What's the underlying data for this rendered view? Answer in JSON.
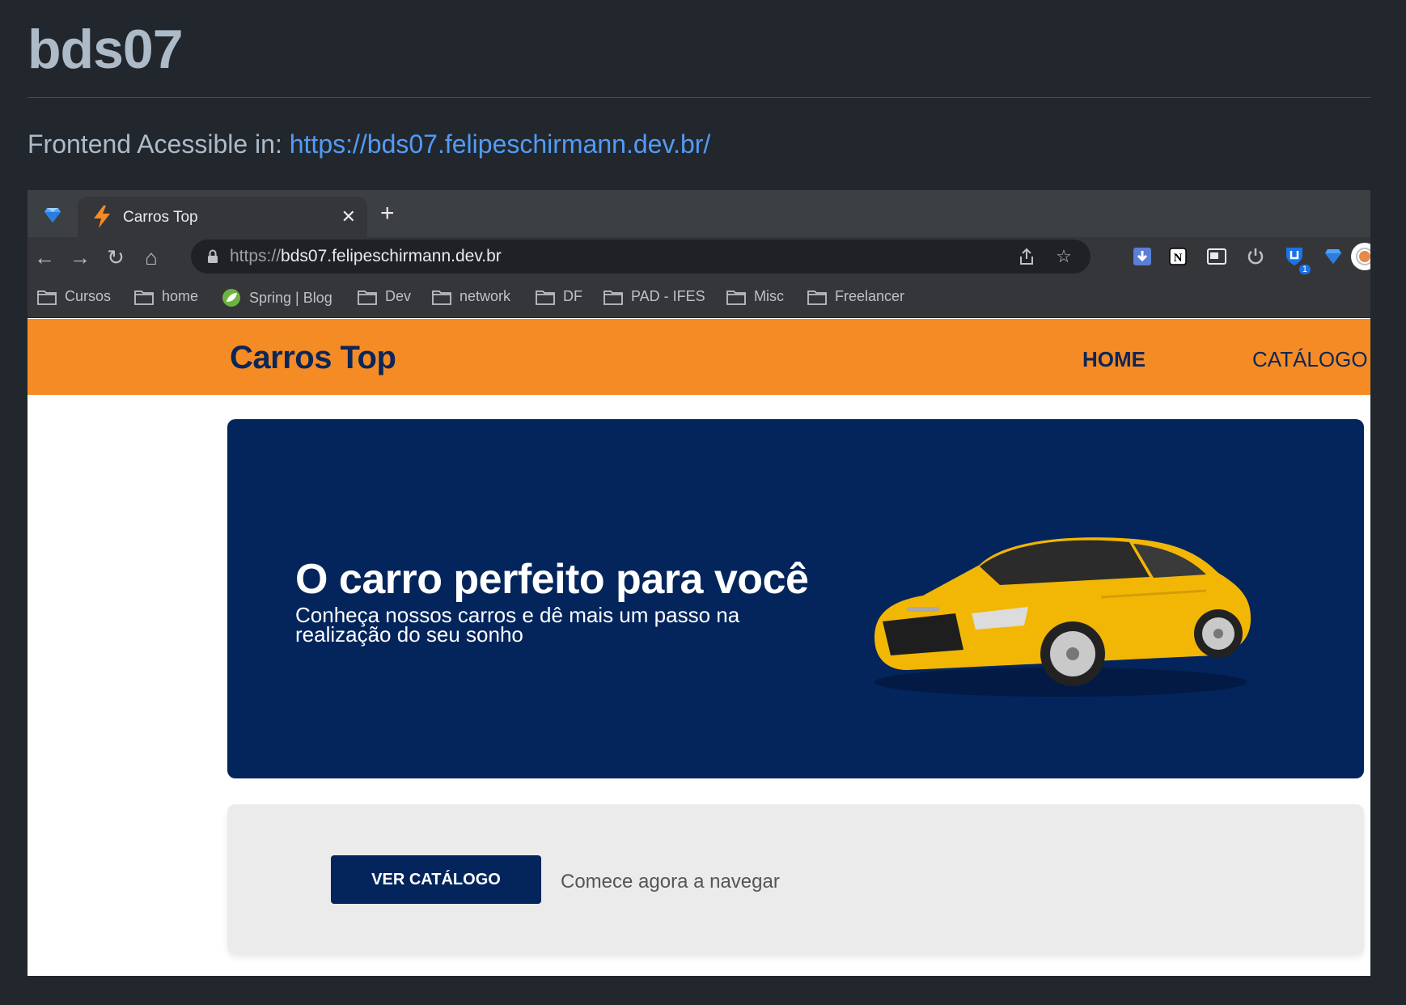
{
  "readme": {
    "title": "bds07",
    "line_prefix": "Frontend Acessible in:",
    "link": "https://bds07.felipeschirmann.dev.br/"
  },
  "browser": {
    "tab_title": "Carros Top",
    "url_scheme": "https://",
    "url_host": "bds07.felipeschirmann.dev.br",
    "extension_badge": "1",
    "bookmarks": [
      "Cursos",
      "home",
      "Spring | Blog",
      "Dev",
      "network",
      "DF",
      "PAD - IFES",
      "Misc",
      "Freelancer"
    ]
  },
  "site": {
    "brand": "Carros Top",
    "nav_home": "HOME",
    "nav_catalog": "CATÁLOGO",
    "hero_title": "O carro perfeito para você",
    "hero_subtitle": "Conheça nossos carros e dê mais um passo na realização do seu sonho",
    "cta_button": "VER CATÁLOGO",
    "cta_text": "Comece agora a navegar"
  },
  "colors": {
    "page_bg": "#22272e",
    "link": "#539bf5",
    "nav_orange": "#f58b24",
    "hero_navy": "#03255c"
  }
}
